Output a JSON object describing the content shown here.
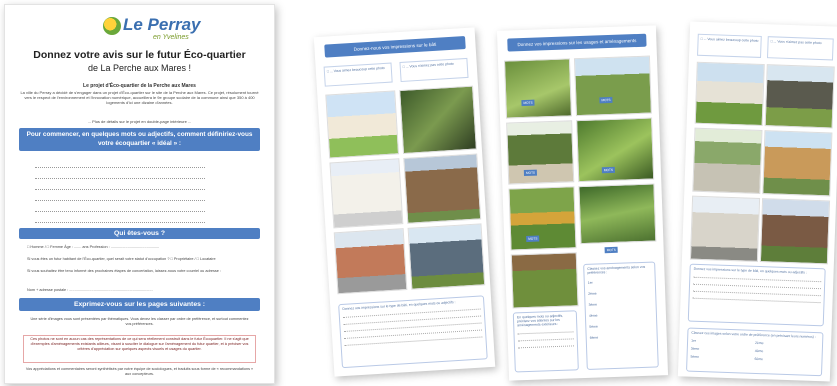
{
  "page1": {
    "logo_text": "Le Perray",
    "logo_sub": "en Yvelines",
    "title": "Donnez votre avis sur le futur Éco-quartier",
    "subtitle": "de La Perche aux Mares !",
    "intro_title": "Le projet d'Éco-quartier de la Perche aux Mares",
    "intro_text": "La ville du Perray a décidé de s'engager dans un projet d'Éco-quartier sur le site de la Perche aux Mares. Ce projet, résolument tourné vers le respect de l'environnement et l'innovation numérique, accueillera le 9e groupe scolaire de la commune ainsi que 350 à 400 logements d'ici une dizaine d'années.",
    "more_text": "... Plus de détails sur le projet en double-page intérieure ...",
    "band1": "Pour commencer, en quelques mots ou adjectifs, comment définiriez-vous votre écoquartier « idéal » :",
    "band2": "Qui êtes-vous ?",
    "form_row1": "□ Homme / □ Femme     Âge : ....... ans           Profession : ..............................................",
    "form_row2": "Si vous êtes un futur habitant de l'Éco-quartier, quel serait votre statut d'occupation ?  □ Propriétaire / □ Locataire",
    "form_row3": "Si vous souhaitez être tenu informé des prochaines étapes de concertation, laissez-nous votre courriel ou adresse :",
    "form_row4": "Nom + adresse postale : ...............................................................................",
    "band3": "Exprimez-vous sur les pages suivantes :",
    "note": "Une série d'images vous sont présentées par thématiques. Vous devez les classer par ordre de préférence, et surtout commentez vos préférences.",
    "red_text": "Ces photos ne sont en aucun cas des représentations de ce qui sera réellement construit dans le futur Écoquartier. Il ne s'agit que d'exemples d'aménagements existants ailleurs, visant à susciter le dialogue sur l'aménagement du futur quartier, et à préciser vos critères d'appréciation sur quelques aspects visuels et usages du quartier.",
    "foot": "Vos appréciations et commentaires seront synthétisés par notre équipe de sociologues, et traduits sous forme de « recommandations » aux concepteurs."
  },
  "page2": {
    "header": "Donnez-nous vos impressions sur le bâti",
    "legend1": "□ ... Vous aimez beaucoup cette photo",
    "legend2": "□ ... Vous n'aimez pas cette photo",
    "question": "Donnez vos impressions sur le type de bâti, en quelques mots ou adjectifs :"
  },
  "page3": {
    "header": "Donnez vos impressions sur les usages et aménagements extérieurs",
    "tags": [
      "MOTS",
      "MOTS",
      "MOTS",
      "MOTS",
      "MOTS",
      "MOTS"
    ],
    "question1": "En quelques mots ou adjectifs, précisez vos attentes sur les aménagements extérieurs :",
    "question2": "Classez vos aménagements selon vos préférences :",
    "ranks": [
      "1er",
      "2ème",
      "3ème",
      "4ème",
      "5ème",
      "6ème"
    ]
  },
  "page4": {
    "legend1": "□ ... Vous aimez beaucoup cette photo",
    "legend2": "□ ... Vous n'aimez pas cette photo",
    "question1": "Donnez vos impressions sur le type de bâti, en quelques mots ou adjectifs :",
    "question2": "Classez ces images selon votre ordre de préférence (en précisant leurs numéros) :",
    "ranks": [
      "1er",
      "2ème",
      "3ème",
      "4ème",
      "5ème",
      "6ème"
    ]
  }
}
